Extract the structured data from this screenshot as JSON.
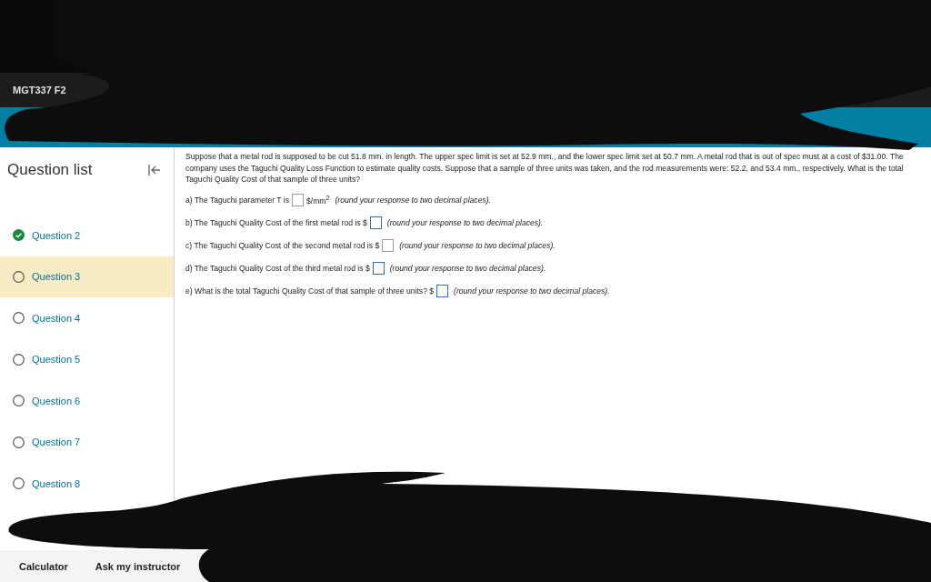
{
  "course": {
    "title": "MGT337 F2"
  },
  "question_list": {
    "title": "Question list",
    "items": [
      {
        "label": "Question 2",
        "completed": true,
        "selected": false
      },
      {
        "label": "Question 3",
        "completed": false,
        "selected": true
      },
      {
        "label": "Question 4",
        "completed": false,
        "selected": false
      },
      {
        "label": "Question 5",
        "completed": false,
        "selected": false
      },
      {
        "label": "Question 6",
        "completed": false,
        "selected": false
      },
      {
        "label": "Question 7",
        "completed": false,
        "selected": false
      },
      {
        "label": "Question 8",
        "completed": false,
        "selected": false
      }
    ]
  },
  "question": {
    "text": "Suppose that a metal rod is supposed to be cut 51.8 mm. in length.  The upper spec limit is set at 52.9 mm., and the lower spec limit set at 50.7 mm.  A metal rod that is out of spec must at a cost of $31.00.  The company uses the Taguchi Quality Loss Function to estimate quality costs.  Suppose that a sample of three units was taken, and the rod measurements were: 52.2, and 53.4 mm., respectively. What is the total Taguchi Quality Cost of that sample of three units?",
    "parts": [
      {
        "prompt": "a) The Taguchi parameter T is",
        "unit": "$/mm$^{2}$",
        "hint": "(round your response to two decimal places).",
        "highlighted": false
      },
      {
        "prompt": "b) The Taguchi Quality Cost of the first metal rod is $",
        "hint": "(round your response to two decimal places).",
        "highlighted": true
      },
      {
        "prompt": "c) The Taguchi Quality Cost of the second metal rod is $",
        "hint": "(round your response to two decimal places).",
        "highlighted": false
      },
      {
        "prompt": "d) The Taguchi Quality Cost of the third metal rod is $",
        "hint": "(round your response to two decimal places).",
        "highlighted": true
      },
      {
        "prompt": "e) What is the total Taguchi Quality Cost of that sample of three units? $",
        "hint": "(round your response to two decimal places).",
        "highlighted": true
      }
    ]
  },
  "footer": {
    "links": [
      "Calculator",
      "Ask my instructor"
    ]
  }
}
